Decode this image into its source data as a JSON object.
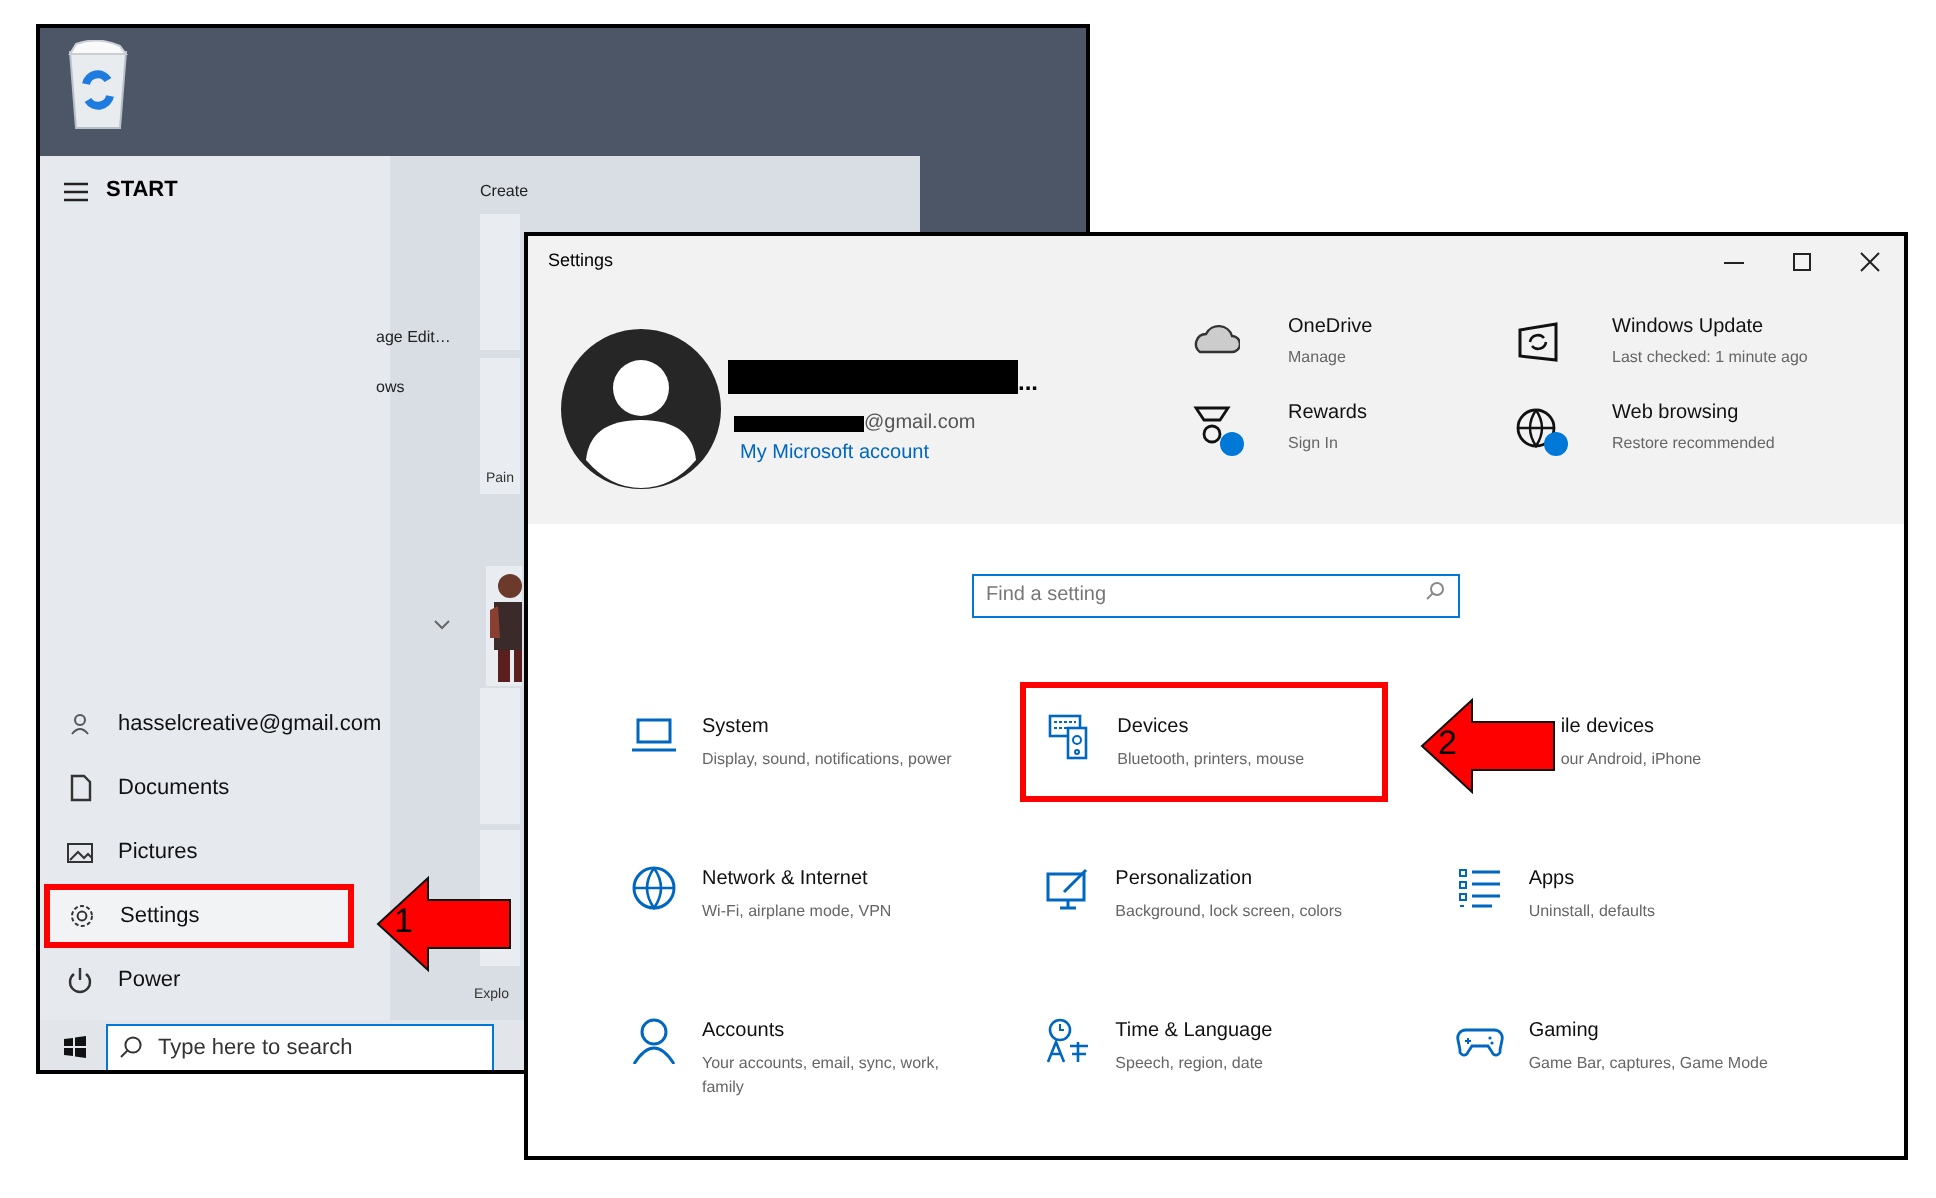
{
  "start_menu": {
    "title": "START",
    "tiles_header": "Create",
    "partial_labels": [
      {
        "text": "age Edit…",
        "kind": "app"
      },
      {
        "text": "ows",
        "kind": "app"
      },
      {
        "text": "Pain",
        "kind": "tile"
      },
      {
        "text": "Explo",
        "kind": "tile"
      }
    ],
    "places": [
      {
        "label": "hasselcreative@gmail.com",
        "kind": "account",
        "highlighted": false
      },
      {
        "label": "Documents",
        "kind": "documents",
        "highlighted": false
      },
      {
        "label": "Pictures",
        "kind": "pictures",
        "highlighted": false
      },
      {
        "label": "Settings",
        "kind": "settings",
        "highlighted": true
      },
      {
        "label": "Power",
        "kind": "power",
        "highlighted": false
      }
    ]
  },
  "taskbar": {
    "search_placeholder": "Type here to search"
  },
  "settings_window": {
    "title": "Settings",
    "account": {
      "name_suffix": "...",
      "email_suffix": "@gmail.com",
      "link": "My Microsoft account"
    },
    "services": [
      {
        "title": "OneDrive",
        "subtitle": "Manage",
        "kind": "cloud",
        "badge": false
      },
      {
        "title": "Windows Update",
        "subtitle": "Last checked: 1 minute ago",
        "kind": "update",
        "badge": false
      },
      {
        "title": "Rewards",
        "subtitle": "Sign In",
        "kind": "rewards",
        "badge": true
      },
      {
        "title": "Web browsing",
        "subtitle": "Restore recommended",
        "kind": "globe",
        "badge": true
      }
    ],
    "search": {
      "placeholder": "Find a setting"
    },
    "categories": [
      {
        "title": "System",
        "subtitle": "Display, sound, notifications, power",
        "kind": "laptop",
        "highlighted": false
      },
      {
        "title": "Devices",
        "subtitle": "Bluetooth, printers, mouse",
        "kind": "devices",
        "highlighted": true
      },
      {
        "title": "ile devices",
        "subtitle": "our Android, iPhone",
        "kind": "covered",
        "highlighted": false
      },
      {
        "title": "Network & Internet",
        "subtitle": "Wi-Fi, airplane mode, VPN",
        "kind": "globe",
        "highlighted": false
      },
      {
        "title": "Personalization",
        "subtitle": "Background, lock screen, colors",
        "kind": "brush",
        "highlighted": false
      },
      {
        "title": "Apps",
        "subtitle": "Uninstall, defaults",
        "kind": "list",
        "highlighted": false
      },
      {
        "title": "Accounts",
        "subtitle": "Your accounts, email, sync, work, family",
        "kind": "person",
        "highlighted": false
      },
      {
        "title": "Time & Language",
        "subtitle": "Speech, region, date",
        "kind": "language",
        "highlighted": false
      },
      {
        "title": "Gaming",
        "subtitle": "Game Bar, captures, Game Mode",
        "kind": "gamepad",
        "highlighted": false
      }
    ]
  },
  "annotations": [
    {
      "label": "1"
    },
    {
      "label": "2"
    }
  ]
}
